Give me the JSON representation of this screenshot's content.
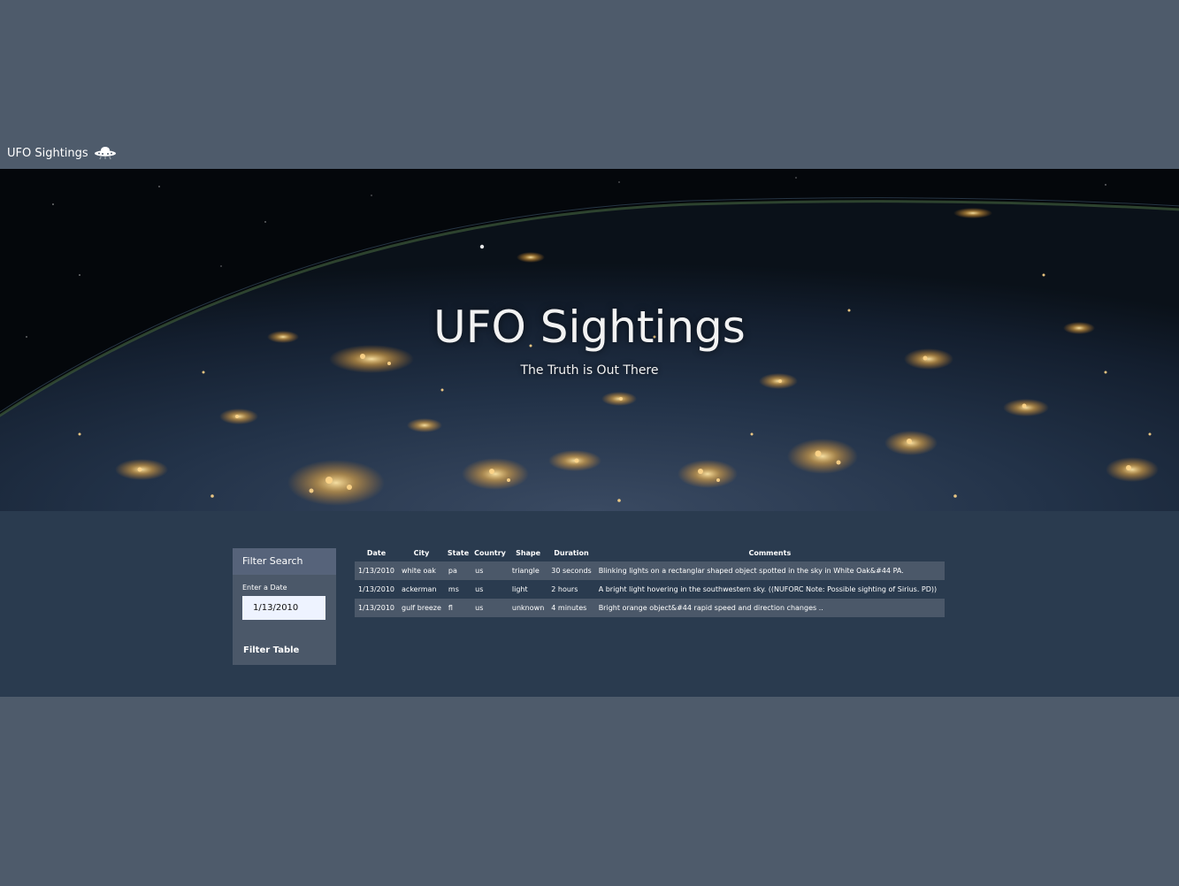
{
  "navbar": {
    "brand": "UFO Sightings",
    "brand_icon": "ufo-icon"
  },
  "hero": {
    "title": "UFO Sightings",
    "subtitle": "The Truth is Out There"
  },
  "filter": {
    "header": "Filter Search",
    "date_label": "Enter a Date",
    "date_value": "1/13/2010",
    "button_label": "Filter Table"
  },
  "table": {
    "headers": [
      "Date",
      "City",
      "State",
      "Country",
      "Shape",
      "Duration",
      "Comments"
    ],
    "rows": [
      [
        "1/13/2010",
        "white oak",
        "pa",
        "us",
        "triangle",
        "30 seconds",
        "Blinking lights on a rectanglar shaped object spotted in the sky in White Oak&#44 PA."
      ],
      [
        "1/13/2010",
        "ackerman",
        "ms",
        "us",
        "light",
        "2 hours",
        "A bright light hovering in the southwestern sky. ((NUFORC Note: Possible sighting of Sirius. PD))"
      ],
      [
        "1/13/2010",
        "gulf breeze",
        "fl",
        "us",
        "unknown",
        "4 minutes",
        "Bright orange object&#44 rapid speed and direction changes .."
      ]
    ]
  },
  "colors": {
    "page_bg": "#4e5b6b",
    "content_bg": "#2a3b4f",
    "panel_bg": "#4b5869",
    "striped_row": "#4b5869",
    "input_bg": "#eef3ff"
  }
}
